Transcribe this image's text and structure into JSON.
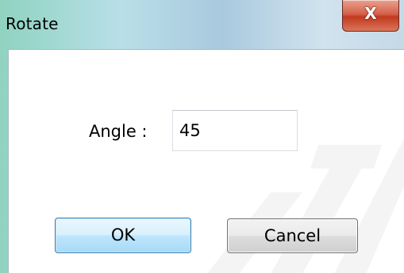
{
  "window": {
    "title": "Rotate",
    "close_glyph": "X"
  },
  "form": {
    "angle_label": "Angle :",
    "angle_value": "45"
  },
  "buttons": {
    "ok_label": "OK",
    "cancel_label": "Cancel"
  },
  "icons": {
    "close": "close-icon"
  },
  "colors": {
    "close_button": "#c2391f",
    "ok_button_border": "#3c7fb1",
    "titlebar_accent": "#8fd3c0"
  }
}
